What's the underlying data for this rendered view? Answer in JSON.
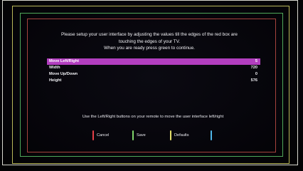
{
  "intro": {
    "line1": "Please setup your user interface by adjusting the values till the edges of the red box are",
    "line2": "touching the edges of your TV.",
    "line3": "When you are ready press green to continue."
  },
  "settings": [
    {
      "label": "Move Left/Right",
      "value": "5"
    },
    {
      "label": "Width",
      "value": "720"
    },
    {
      "label": "Move Up/Down",
      "value": "0"
    },
    {
      "label": "Height",
      "value": "576"
    }
  ],
  "hint": "Use the Left/Right buttons on your remote to move the user interface left/right",
  "buttons": {
    "cancel": {
      "label": "Cancel",
      "color": "#e53f47"
    },
    "save": {
      "label": "Save",
      "color": "#7fd66a"
    },
    "defaults": {
      "label": "Defaults",
      "color": "#e4e06a"
    },
    "blue": {
      "label": "",
      "color": "#4fb5e8"
    }
  },
  "colors": {
    "highlight": "#b23ebf",
    "frame_white": "#d8d8d0",
    "frame_yellow": "#b9b85a",
    "frame_green": "#4fa85a",
    "frame_red": "#a6423d"
  }
}
